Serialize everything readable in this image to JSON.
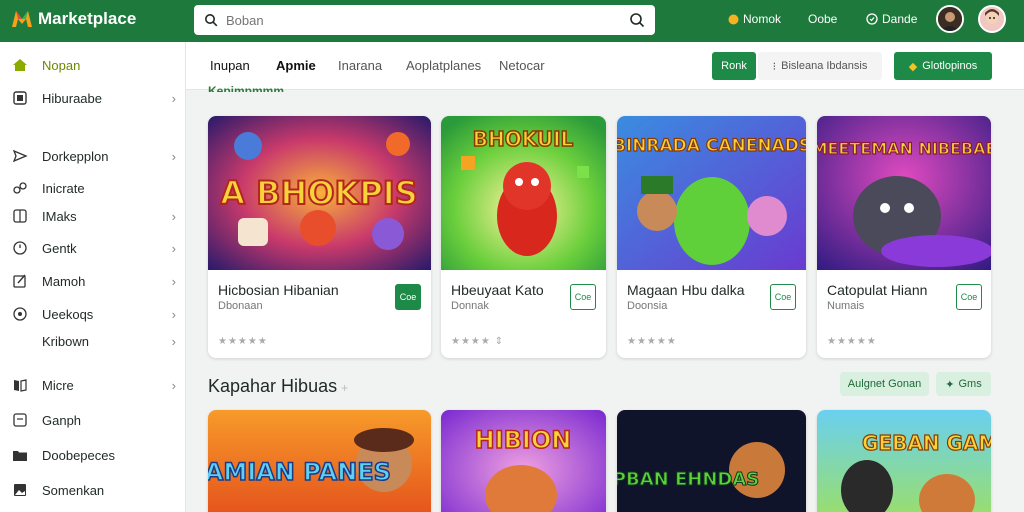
{
  "colors": {
    "brand": "#1e7a3c",
    "accent": "#1e8a47",
    "active_nav": "#6a8a00"
  },
  "header": {
    "app_name": "Marketplace",
    "search_placeholder": "Boban",
    "links": [
      {
        "label": "Nomok",
        "icon": "coin-icon"
      },
      {
        "label": "Oobe",
        "icon": "eye-icon"
      },
      {
        "label": "Dande",
        "icon": "chat-icon"
      }
    ]
  },
  "sidebar": {
    "items": [
      {
        "label": "Nopan",
        "icon": "home-icon",
        "chevron": false
      },
      {
        "label": "Hiburaabe",
        "icon": "square-icon",
        "chevron": true
      },
      {
        "label": "Dorkepplon",
        "icon": "send-icon",
        "chevron": true
      },
      {
        "label": "Inicrate",
        "icon": "link-icon",
        "chevron": false
      },
      {
        "label": "IMaks",
        "icon": "grid-icon",
        "chevron": true
      },
      {
        "label": "Gentk",
        "icon": "clock-icon",
        "chevron": true
      },
      {
        "label": "Mamoh",
        "icon": "edit-icon",
        "chevron": true
      },
      {
        "label": "Ueekoqs",
        "icon": "settings-icon",
        "chevron": true
      },
      {
        "label": "Kribown",
        "icon": "",
        "chevron": true
      },
      {
        "label": "Micre",
        "icon": "book-icon",
        "chevron": true
      },
      {
        "label": "Ganph",
        "icon": "doc-icon",
        "chevron": false
      },
      {
        "label": "Doobepeces",
        "icon": "folder-icon",
        "chevron": false
      },
      {
        "label": "Somenkan",
        "icon": "image-icon",
        "chevron": false
      }
    ]
  },
  "tabs": [
    "Inupan",
    "Apmie",
    "Inarana",
    "Aoplatplanes",
    "Netocar"
  ],
  "toolbar": {
    "rank_label": "Ronk",
    "filter_label": "Bisleana Ibdansis",
    "action_label": "Glotlopinos"
  },
  "section1": {
    "subtitle": "Kepjmpmmm",
    "cards": [
      {
        "art_text": "A BHOKPIS",
        "title": "Hicbosian Hibanian",
        "sub": "Dbonaan",
        "stars": "★★★★★",
        "get": "Coe"
      },
      {
        "art_text": "BHOKUIL",
        "title": "Hbeuyaat Kato",
        "sub": "Donnak",
        "stars": "★★★★ ⇕",
        "get": "Coe"
      },
      {
        "art_text": "BINRADA CANENADS",
        "title": "Magaan Hbu dalka",
        "sub": "Doonsia",
        "stars": "★★★★★",
        "get": "Coe"
      },
      {
        "art_text": "MEETEMAN NIBEBAE",
        "title": "Catopulat Hiann",
        "sub": "Numais",
        "stars": "★★★★★",
        "get": "Coe"
      }
    ]
  },
  "section2": {
    "title": "Kapahar Hibuas",
    "pill1": "Aulgnet Gonan",
    "pill2": "Gms",
    "cards": [
      {
        "art_text": "GAMIAN PANES"
      },
      {
        "art_text": "HIBION"
      },
      {
        "art_text": "BEPBAN EHNDAS"
      },
      {
        "art_text": "GEBAN GAME"
      }
    ]
  }
}
